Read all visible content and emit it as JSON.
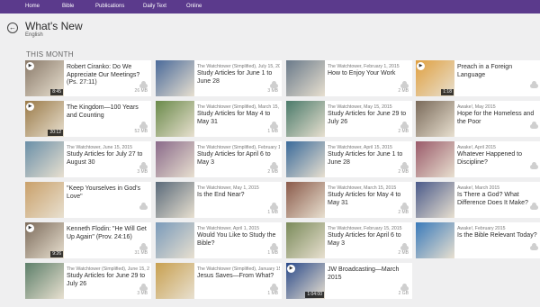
{
  "topnav": [
    "Home",
    "Bible",
    "Publications",
    "Daily Text",
    "Online"
  ],
  "header": {
    "title": "What's New",
    "language": "English"
  },
  "section": "THIS MONTH",
  "colors": {
    "topbar": "#5b3a8c",
    "tile": "#ffffff",
    "background": "#efeff0"
  },
  "tiles": [
    {
      "source": "",
      "title": "Robert Ciranko: Do We Appreciate Our Meetings? (Ps. 27:11)",
      "size": "26 MB",
      "play": true,
      "duration": "8:45",
      "thumb_color": "#8a7a6a"
    },
    {
      "source": "",
      "title": "The Kingdom—100 Years and Counting",
      "size": "52 MB",
      "play": true,
      "duration": "20:12",
      "thumb_color": "#9a7a48"
    },
    {
      "source": "The Watchtower, June 15, 2015",
      "title": "Study Articles for July 27 to August 30",
      "size": "3 MB",
      "play": false,
      "duration": "",
      "thumb_color": "#6a8fa8"
    },
    {
      "source": "",
      "title": "\"Keep Yourselves in God's Love\"",
      "size": "",
      "play": false,
      "duration": "",
      "thumb_color": "#c9a06a"
    },
    {
      "source": "",
      "title": "Kenneth Flodin: \"He Will Get Up Again\" (Prov. 24:16)",
      "size": "31 MB",
      "play": true,
      "duration": "9:26",
      "thumb_color": "#7d6c5c"
    },
    {
      "source": "The Watchtower (Simplified), June 15, 2015",
      "title": "Study Articles for June 29 to July 26",
      "size": "3 MB",
      "play": false,
      "duration": "",
      "thumb_color": "#5d7f6a"
    },
    {
      "source": "The Watchtower (Simplified), July 15, 2015",
      "title": "Study Articles for June 1 to June 28",
      "size": "3 MB",
      "play": false,
      "duration": "",
      "thumb_color": "#4a6a9a"
    },
    {
      "source": "The Watchtower (Simplified), March 15, 2015",
      "title": "Study Articles for May 4 to May 31",
      "size": "1 MB",
      "play": false,
      "duration": "",
      "thumb_color": "#6a8a4a"
    },
    {
      "source": "The Watchtower (Simplified), February 15, 2015",
      "title": "Study Articles for April 6 to May 3",
      "size": "2 MB",
      "play": false,
      "duration": "",
      "thumb_color": "#8a6a8a"
    },
    {
      "source": "The Watchtower, May 1, 2015",
      "title": "Is the End Near?",
      "size": "1 MB",
      "play": false,
      "duration": "",
      "thumb_color": "#5a6a7a"
    },
    {
      "source": "The Watchtower, April 1, 2015",
      "title": "Would You Like to Study the Bible?",
      "size": "1 MB",
      "play": false,
      "duration": "",
      "thumb_color": "#7a9aba"
    },
    {
      "source": "The Watchtower (Simplified), January 15, 2015",
      "title": "Jesus Saves—From What?",
      "size": "1 MB",
      "play": false,
      "duration": "",
      "thumb_color": "#c8a050"
    },
    {
      "source": "The Watchtower, February 1, 2015",
      "title": "How to Enjoy Your Work",
      "size": "2 MB",
      "play": false,
      "duration": "",
      "thumb_color": "#6a7a8a"
    },
    {
      "source": "The Watchtower, May 15, 2015",
      "title": "Study Articles for June 29 to July 26",
      "size": "2 MB",
      "play": false,
      "duration": "",
      "thumb_color": "#4a7a6a"
    },
    {
      "source": "The Watchtower, April 15, 2015",
      "title": "Study Articles for June 1 to June 28",
      "size": "2 MB",
      "play": false,
      "duration": "",
      "thumb_color": "#3a6a9a"
    },
    {
      "source": "The Watchtower, March 15, 2015",
      "title": "Study Articles for May 4 to May 31",
      "size": "2 MB",
      "play": false,
      "duration": "",
      "thumb_color": "#8a5a4a"
    },
    {
      "source": "The Watchtower, February 15, 2015",
      "title": "Study Articles for April 6 to May 3",
      "size": "2 MB",
      "play": false,
      "duration": "",
      "thumb_color": "#7a8a5a"
    },
    {
      "source": "",
      "title": "JW Broadcasting—March 2015",
      "size": "2 GB",
      "play": true,
      "duration": "1:04:00",
      "thumb_color": "#2a4a8a"
    },
    {
      "source": "",
      "title": "Preach in a Foreign Language",
      "size": "",
      "play": true,
      "duration": "1:18",
      "thumb_color": "#e0a040"
    },
    {
      "source": "Awake!, May 2015",
      "title": "Hope for the Homeless and the Poor",
      "size": "",
      "play": false,
      "duration": "",
      "thumb_color": "#7a6a5a"
    },
    {
      "source": "Awake!, April 2015",
      "title": "Whatever Happened to Discipline?",
      "size": "",
      "play": false,
      "duration": "",
      "thumb_color": "#9a5a6a"
    },
    {
      "source": "Awake!, March 2015",
      "title": "Is There a God? What Difference Does It Make?",
      "size": "",
      "play": false,
      "duration": "",
      "thumb_color": "#4a5a8a"
    },
    {
      "source": "Awake!, February 2015",
      "title": "Is the Bible Relevant Today?",
      "size": "",
      "play": false,
      "duration": "",
      "thumb_color": "#3a7aba"
    }
  ]
}
